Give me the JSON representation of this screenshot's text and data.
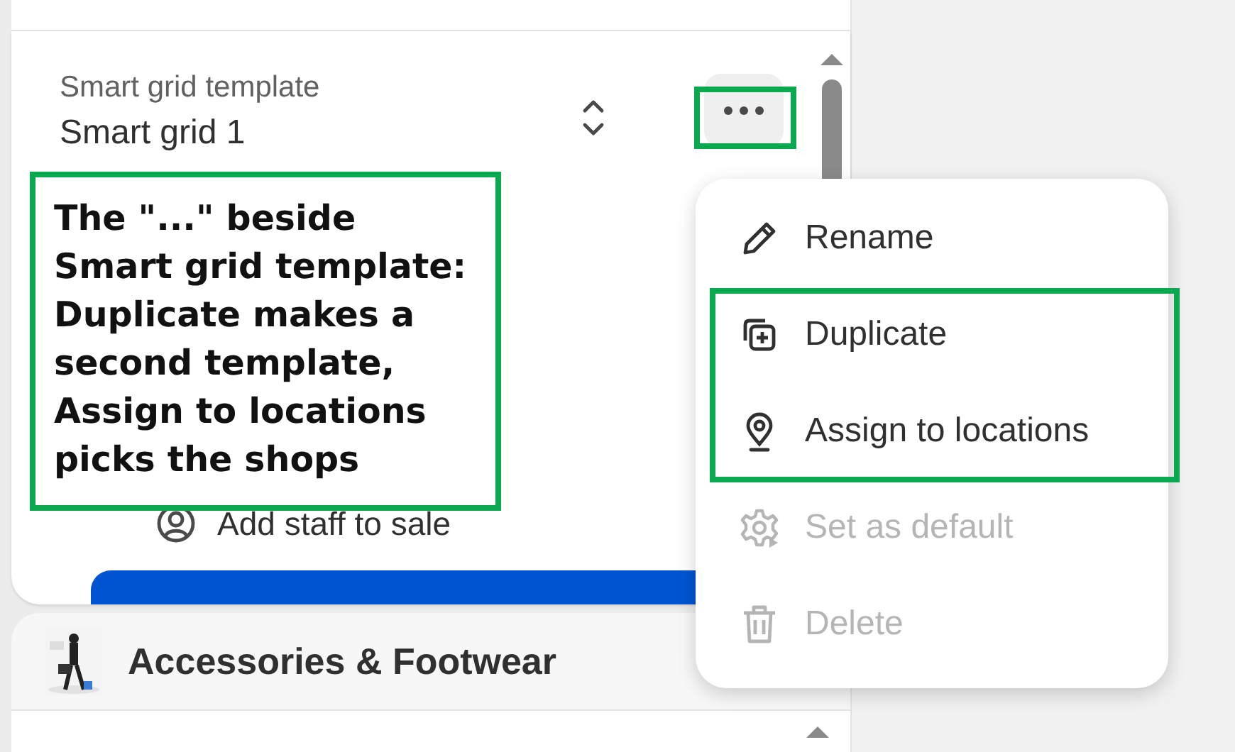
{
  "template_field": {
    "label": "Smart grid template",
    "value": "Smart grid 1"
  },
  "staff_action": {
    "label": "Add staff to sale"
  },
  "category": {
    "title": "Accessories & Footwear"
  },
  "menu": {
    "items": [
      {
        "label": "Rename",
        "disabled": false
      },
      {
        "label": "Duplicate",
        "disabled": false
      },
      {
        "label": "Assign to locations",
        "disabled": false
      },
      {
        "label": "Set as default",
        "disabled": true
      },
      {
        "label": "Delete",
        "disabled": true
      }
    ]
  },
  "annotation": {
    "text": "The \"...\" beside Smart grid template: Duplicate makes a second template, Assign to locations picks the shops"
  }
}
